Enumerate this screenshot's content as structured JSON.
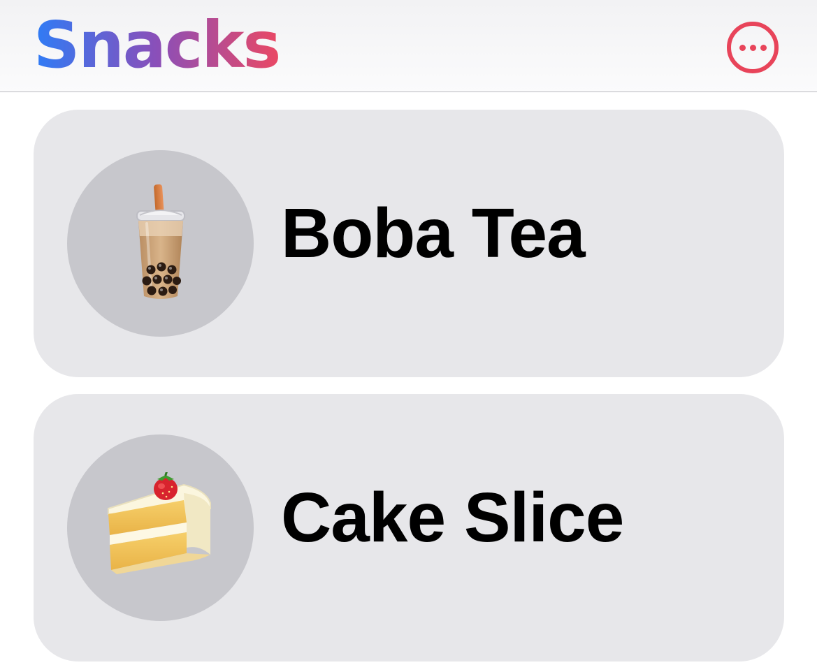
{
  "header": {
    "title": "Snacks",
    "title_gradient": [
      "#2e7cf6",
      "#8a4fb9",
      "#ea4864"
    ],
    "more_icon": "ellipsis-circle-icon",
    "more_color": "#e8445a"
  },
  "snacks": [
    {
      "label": "Boba Tea",
      "icon": "bubble-tea-icon"
    },
    {
      "label": "Cake Slice",
      "icon": "shortcake-icon"
    }
  ],
  "colors": {
    "card_background": "#e7e7ea",
    "avatar_background": "#c7c7cc"
  }
}
